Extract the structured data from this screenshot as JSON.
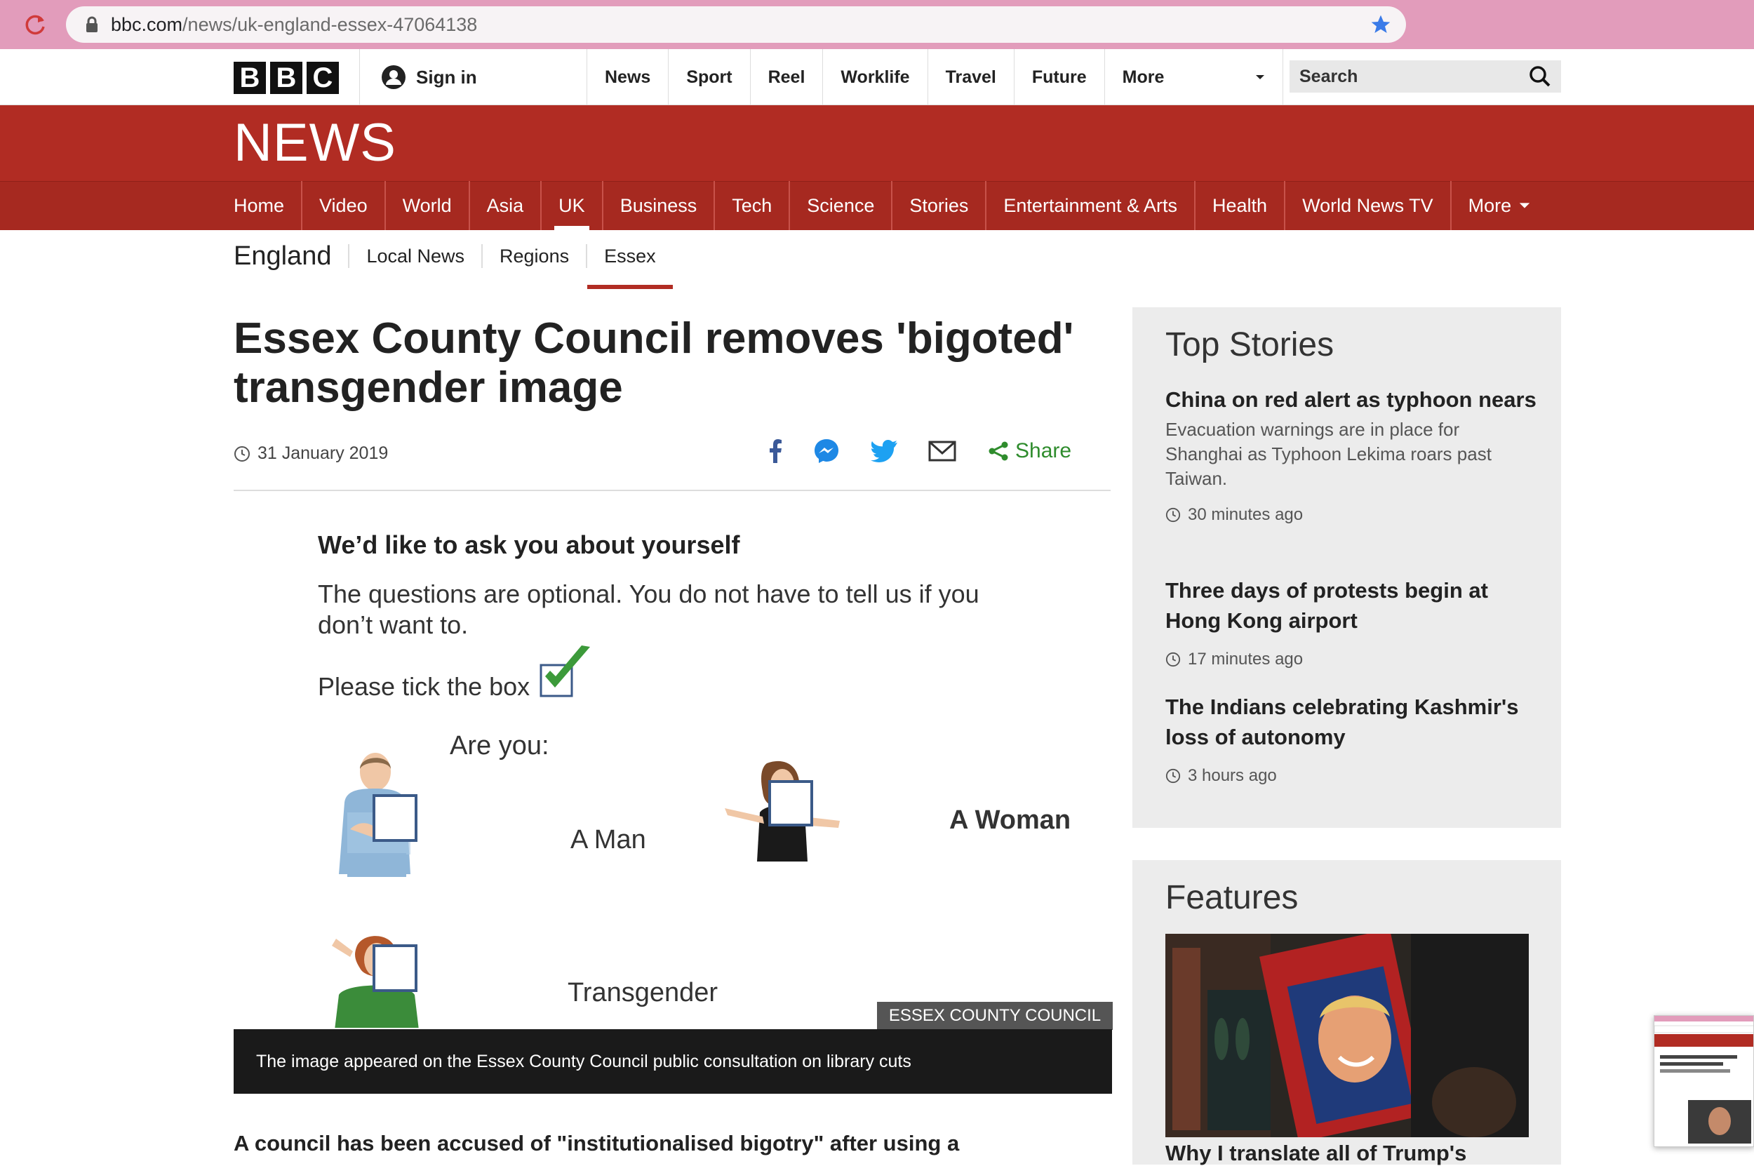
{
  "browser": {
    "url_domain": "bbc.com",
    "url_path": "/news/uk-england-essex-47064138"
  },
  "header": {
    "logo_letters": [
      "B",
      "B",
      "C"
    ],
    "sign_in": "Sign in",
    "nav": [
      "News",
      "Sport",
      "Reel",
      "Worklife",
      "Travel",
      "Future",
      "More"
    ],
    "search_placeholder": "Search"
  },
  "news_banner": "NEWS",
  "news_nav": {
    "items": [
      "Home",
      "Video",
      "World",
      "Asia",
      "UK",
      "Business",
      "Tech",
      "Science",
      "Stories",
      "Entertainment & Arts",
      "Health",
      "World News TV",
      "More"
    ],
    "active": "UK"
  },
  "sub_nav": {
    "heading": "England",
    "items": [
      "Local News",
      "Regions",
      "Essex"
    ],
    "active": "Essex"
  },
  "article": {
    "headline": "Essex County Council removes 'bigoted' transgender image",
    "date": "31 January 2019",
    "share_label": "Share",
    "figure": {
      "heading": "We’d like to ask you about yourself",
      "line1": "The questions are optional.  You do not have to tell us if you",
      "line2": "don’t want to.",
      "tick": "Please tick the box",
      "are_you": "Are you:",
      "opt_man": "A Man",
      "opt_woman": "A Woman",
      "opt_trans": "Transgender"
    },
    "credit": "ESSEX COUNTY COUNCIL",
    "caption": "The image appeared on the Essex County Council public consultation on library cuts",
    "intro": "A council has been accused of \"institutionalised bigotry\" after using a"
  },
  "top_stories": {
    "title": "Top Stories",
    "items": [
      {
        "headline": "China on red alert as typhoon nears",
        "summary": "Evacuation warnings are in place for Shanghai as Typhoon Lekima roars past Taiwan.",
        "time": "30 minutes ago"
      },
      {
        "headline": "Three days of protests begin at Hong Kong airport",
        "summary": "",
        "time": "17 minutes ago"
      },
      {
        "headline": "The Indians celebrating Kashmir's loss of autonomy",
        "summary": "",
        "time": "3 hours ago"
      }
    ]
  },
  "features": {
    "title": "Features",
    "headline": "Why I translate all of Trump's"
  },
  "colors": {
    "bbc_red": "#b12c23",
    "nav_red": "#a62920",
    "share_green": "#2f8c2d",
    "browser_pink": "#e29cbb"
  }
}
